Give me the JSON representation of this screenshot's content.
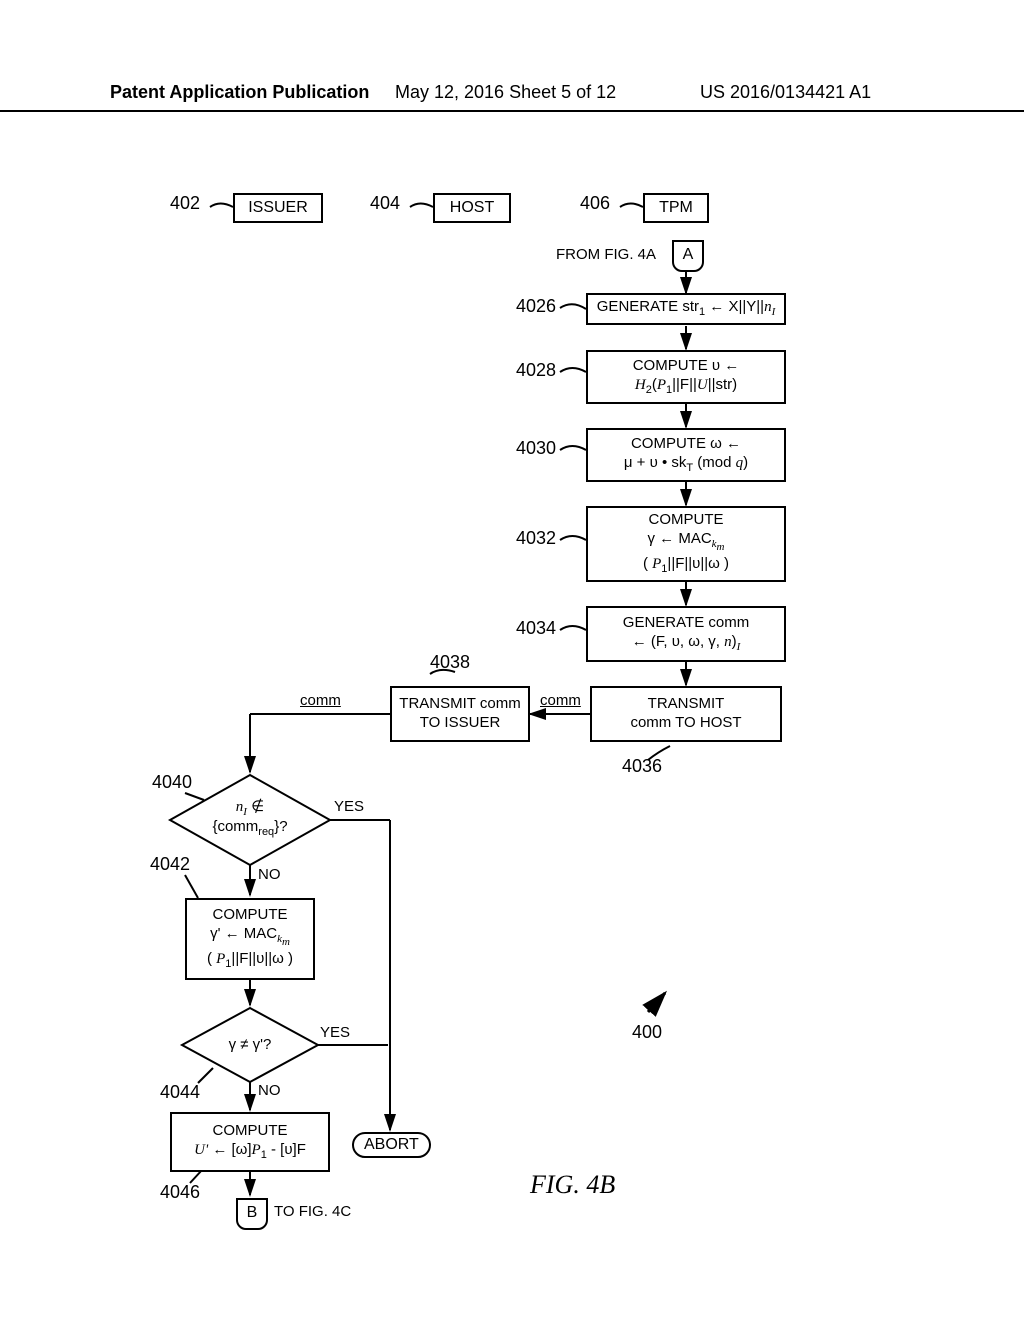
{
  "header": {
    "left": "Patent Application Publication",
    "mid": "May 12, 2016  Sheet 5 of 12",
    "right": "US 2016/0134421 A1"
  },
  "entities": {
    "issuer": "ISSUER",
    "host": "HOST",
    "tpm": "TPM"
  },
  "refs": {
    "issuer": "402",
    "host": "404",
    "tpm": "406",
    "s4026": "4026",
    "s4028": "4028",
    "s4030": "4030",
    "s4032": "4032",
    "s4034": "4034",
    "s4036": "4036",
    "s4038": "4038",
    "s4040": "4040",
    "s4042": "4042",
    "s4044": "4044",
    "s4046": "4046",
    "overall": "400"
  },
  "connectors": {
    "fromA_text": "FROM FIG. 4A",
    "A": "A",
    "B": "B",
    "toB_text": "TO FIG. 4C"
  },
  "steps": {
    "s4026": "GENERATE str₁ ← X||Y||nₐ",
    "s4028_l1": "COMPUTE υ ←",
    "s4028_l2": "H₂(P₁||F||U||str)",
    "s4030_l1": "COMPUTE ω ←",
    "s4030_l2": "μ + υ • skₜ (mod q)",
    "s4032_l1": "COMPUTE",
    "s4032_l2": "γ ← MAC_kₘ",
    "s4032_l3": "( P₁||F||υ||ω )",
    "s4034_l1": "GENERATE comm",
    "s4034_l2": "← (F, υ, ω, γ, n)ₐ",
    "s4036_l1": "TRANSMIT",
    "s4036_l2": "comm TO HOST",
    "s4038_l1": "TRANSMIT comm",
    "s4038_l2": "TO ISSUER",
    "comm": "comm",
    "d4040_l1": "nₐ ∉",
    "d4040_l2": "{comm_req}?",
    "s4042_l1": "COMPUTE",
    "s4042_l2": "γ' ← MAC_kₘ",
    "s4042_l3": "( P₁||F||υ||ω )",
    "d4044": "γ ≠ γ'?",
    "s4046_l1": "COMPUTE",
    "s4046_l2": "U' ← [ω]P₁ - [υ]F",
    "yes": "YES",
    "no": "NO",
    "abort": "ABORT"
  },
  "figure": "FIG. 4B"
}
